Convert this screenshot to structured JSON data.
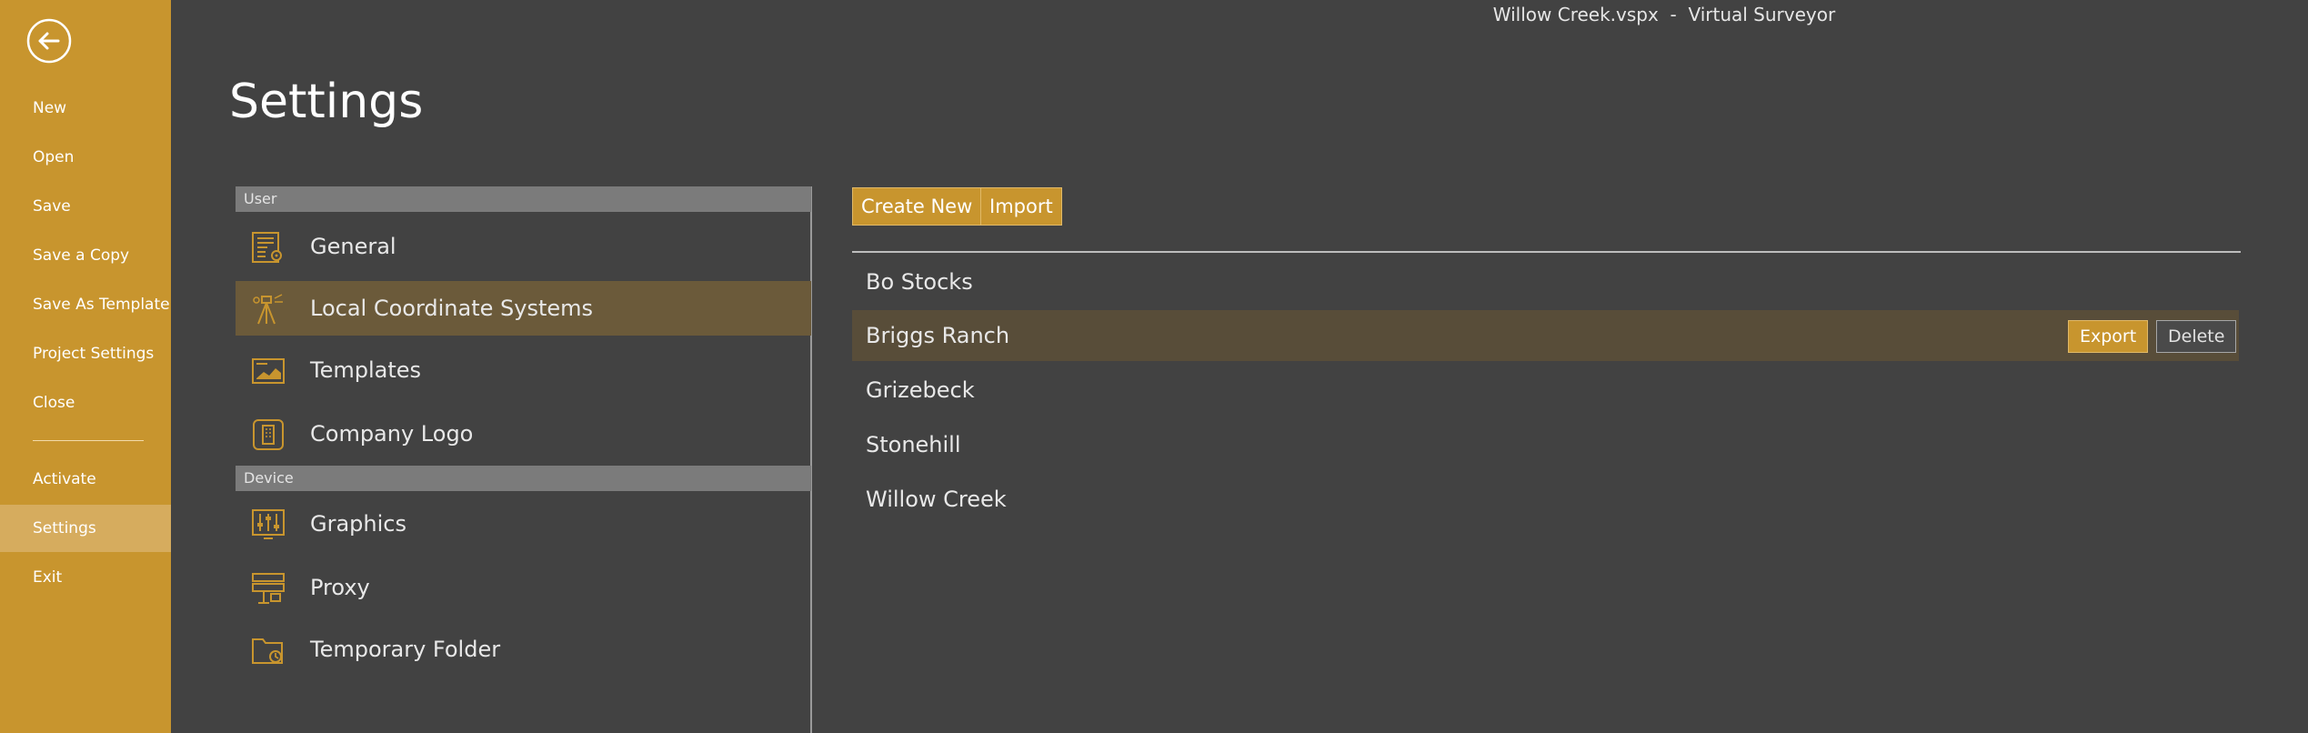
{
  "window": {
    "title": "Willow Creek.vspx  -  Virtual Surveyor"
  },
  "sidebar": {
    "back_icon": "arrow-left-circle-icon",
    "items": [
      {
        "label": "New"
      },
      {
        "label": "Open"
      },
      {
        "label": "Save"
      },
      {
        "label": "Save a Copy"
      },
      {
        "label": "Save As Template"
      },
      {
        "label": "Project Settings"
      },
      {
        "label": "Close"
      },
      {
        "label": "Activate"
      },
      {
        "label": "Settings",
        "active": true
      },
      {
        "label": "Exit"
      }
    ]
  },
  "page": {
    "title": "Settings"
  },
  "categories": {
    "user_header": "User",
    "device_header": "Device",
    "items": [
      {
        "label": "General",
        "icon": "document-gear-icon"
      },
      {
        "label": "Local Coordinate Systems",
        "icon": "surveyor-tripod-icon",
        "active": true
      },
      {
        "label": "Templates",
        "icon": "template-chart-icon"
      },
      {
        "label": "Company Logo",
        "icon": "company-building-icon"
      },
      {
        "label": "Graphics",
        "icon": "sliders-monitor-icon"
      },
      {
        "label": "Proxy",
        "icon": "network-server-icon"
      },
      {
        "label": "Temporary Folder",
        "icon": "folder-clock-icon"
      }
    ]
  },
  "toolbar": {
    "create_new": "Create New",
    "import": "Import"
  },
  "coordinate_systems": {
    "rows": [
      {
        "name": "Bo Stocks"
      },
      {
        "name": "Briggs Ranch",
        "active": true
      },
      {
        "name": "Grizebeck"
      },
      {
        "name": "Stonehill"
      },
      {
        "name": "Willow Creek"
      }
    ],
    "export_label": "Export",
    "delete_label": "Delete"
  },
  "colors": {
    "accent": "#c8952e",
    "sidebar_active": "#d6ac5e",
    "background": "#424242",
    "selected_row": "#584d39",
    "selected_category": "#6b5a3a"
  }
}
